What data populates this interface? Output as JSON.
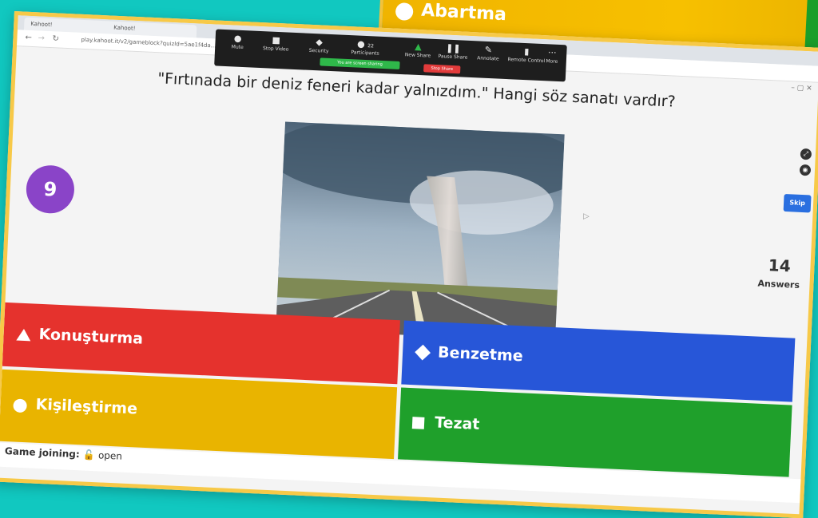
{
  "back_card": {
    "answer_label": "Abartma"
  },
  "browser": {
    "tabs": [
      "Kahoot!",
      "Kahoot!"
    ],
    "url": "play.kahoot.it/v2/gameblock?quizId=5ae1f4da..."
  },
  "zoom_toolbar": {
    "mute": "Mute",
    "stop_video": "Stop Video",
    "security": "Security",
    "participants": "Participants",
    "participants_count": "22",
    "new_share": "New Share",
    "pause_share": "Pause Share",
    "annotate": "Annotate",
    "remote_control": "Remote Control",
    "more": "More",
    "sharing_notice": "You are screen sharing",
    "stop_share": "Stop Share"
  },
  "question": "\"Fırtınada bir deniz feneri kadar yalnızdım.\" Hangi söz sanatı vardır?",
  "timer": "9",
  "answers_count": "14",
  "answers_label": "Answers",
  "skip_label": "Skip",
  "answers": {
    "red": "Konuşturma",
    "blue": "Benzetme",
    "yellow": "Kişileştirme",
    "green": "Tezat"
  },
  "game_joining": "Game joining:",
  "game_joining_status": "open",
  "colors": {
    "timer": "#8a44c8",
    "red": "#e5322d",
    "blue": "#2756d8",
    "yellow": "#e9b400",
    "green": "#1fa02b",
    "skip": "#2a6fe0"
  }
}
